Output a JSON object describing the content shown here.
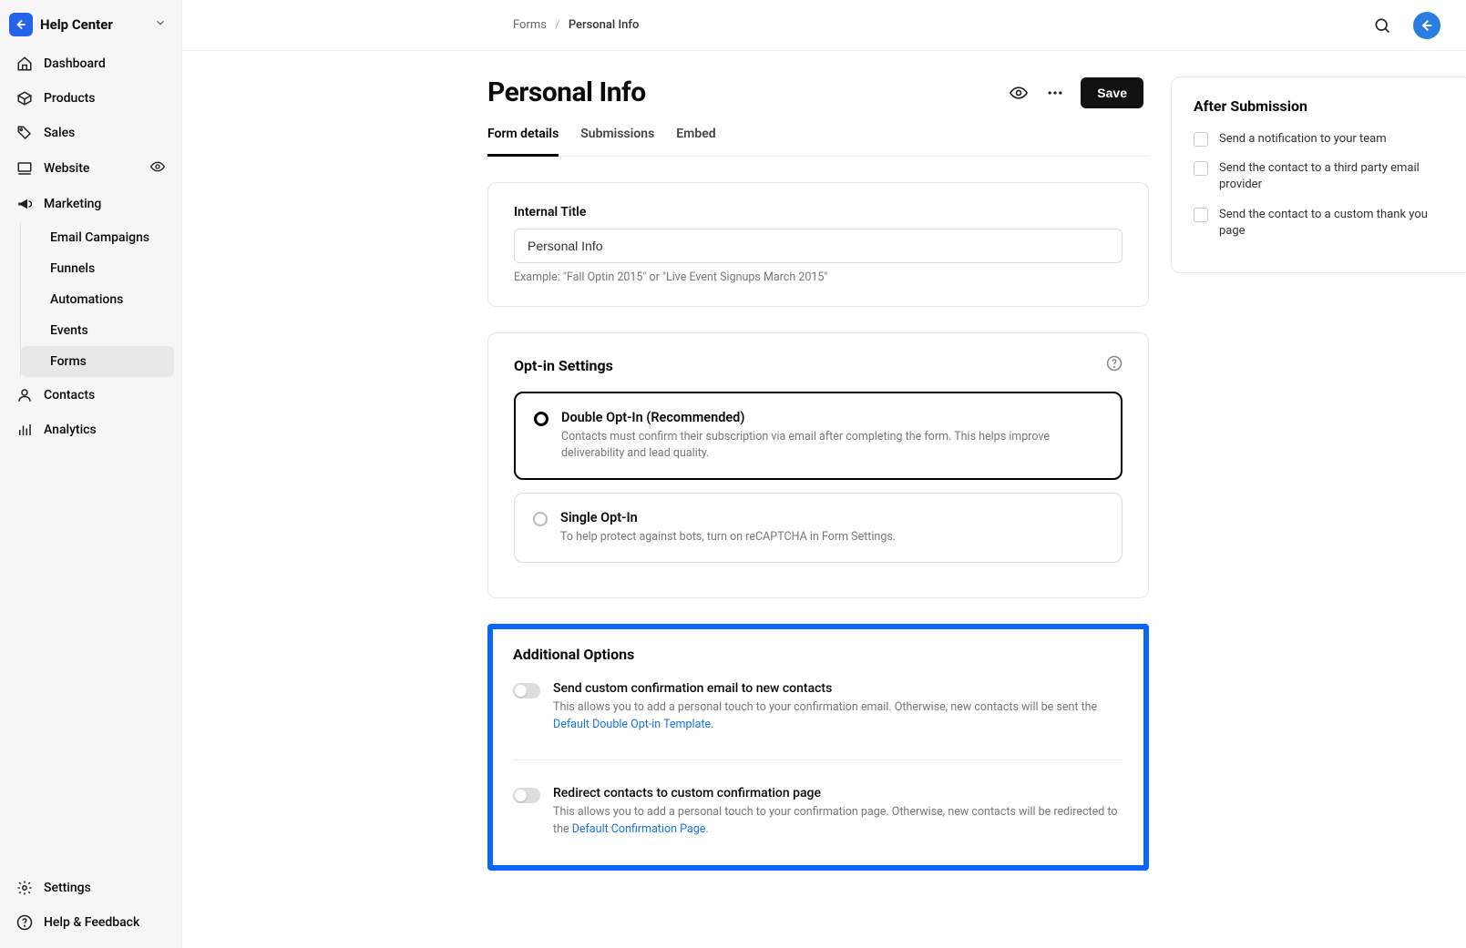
{
  "sidebar": {
    "title": "Help Center",
    "items": [
      {
        "label": "Dashboard",
        "icon": "home"
      },
      {
        "label": "Products",
        "icon": "box"
      },
      {
        "label": "Sales",
        "icon": "tag"
      },
      {
        "label": "Website",
        "icon": "monitor",
        "trailingEye": true
      },
      {
        "label": "Marketing",
        "icon": "megaphone",
        "expanded": true,
        "children": [
          {
            "label": "Email Campaigns"
          },
          {
            "label": "Funnels"
          },
          {
            "label": "Automations"
          },
          {
            "label": "Events"
          },
          {
            "label": "Forms",
            "active": true
          }
        ]
      },
      {
        "label": "Contacts",
        "icon": "user"
      },
      {
        "label": "Analytics",
        "icon": "bars"
      }
    ],
    "footer": [
      {
        "label": "Settings",
        "icon": "gear"
      },
      {
        "label": "Help & Feedback",
        "icon": "help"
      }
    ]
  },
  "breadcrumb": {
    "parent": "Forms",
    "current": "Personal Info"
  },
  "page": {
    "title": "Personal Info",
    "save": "Save",
    "tabs": [
      "Form details",
      "Submissions",
      "Embed"
    ],
    "activeTab": 0
  },
  "internalTitle": {
    "label": "Internal Title",
    "value": "Personal Info",
    "hint": "Example: \"Fall Optin 2015\" or \"Live Event Signups March 2015\""
  },
  "optin": {
    "title": "Opt-in Settings",
    "options": [
      {
        "title": "Double Opt-In (Recommended)",
        "desc": "Contacts must confirm their subscription via email after completing the form. This helps improve deliverability and lead quality.",
        "selected": true
      },
      {
        "title": "Single Opt-In",
        "desc": "To help protect against bots, turn on reCAPTCHA in Form Settings.",
        "selected": false
      }
    ]
  },
  "additional": {
    "title": "Additional Options",
    "items": [
      {
        "title": "Send custom confirmation email to new contacts",
        "descPrefix": "This allows you to add a personal touch to your confirmation email. Otherwise, new contacts will be sent the ",
        "link": "Default Double Opt-in Template",
        "descSuffix": "."
      },
      {
        "title": "Redirect contacts to custom confirmation page",
        "descPrefix": "This allows you to add a personal touch to your confirmation page. Otherwise, new contacts will be redirected to the ",
        "link": "Default Confirmation Page",
        "descSuffix": "."
      }
    ]
  },
  "afterSubmission": {
    "title": "After Submission",
    "items": [
      "Send a notification to your team",
      "Send the contact to a third party email provider",
      "Send the contact to a custom thank you page"
    ]
  }
}
